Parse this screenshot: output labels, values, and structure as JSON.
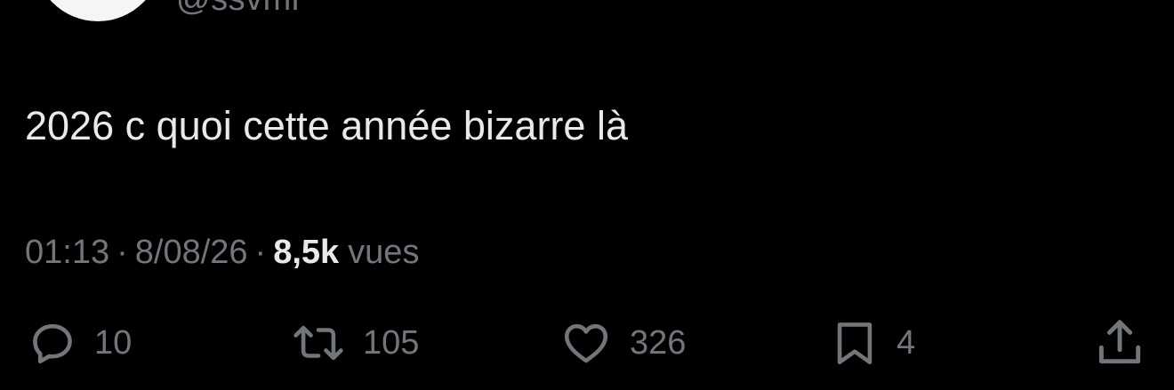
{
  "header": {
    "handle": "@ssvmr"
  },
  "tweet": {
    "text": "2026 c quoi cette année bizarre là",
    "time": "01:13",
    "separator": "·",
    "date": "8/08/26",
    "views_count": "8,5k",
    "views_label": "vues"
  },
  "actions": {
    "replies": {
      "icon": "reply-icon",
      "count": "10"
    },
    "retweets": {
      "icon": "retweet-icon",
      "count": "105"
    },
    "likes": {
      "icon": "heart-icon",
      "count": "326"
    },
    "bookmarks": {
      "icon": "bookmark-icon",
      "count": "4"
    },
    "share": {
      "icon": "share-icon"
    }
  },
  "colors": {
    "background": "#000000",
    "primary_text": "#e7e9ea",
    "secondary_text": "#71767b"
  }
}
